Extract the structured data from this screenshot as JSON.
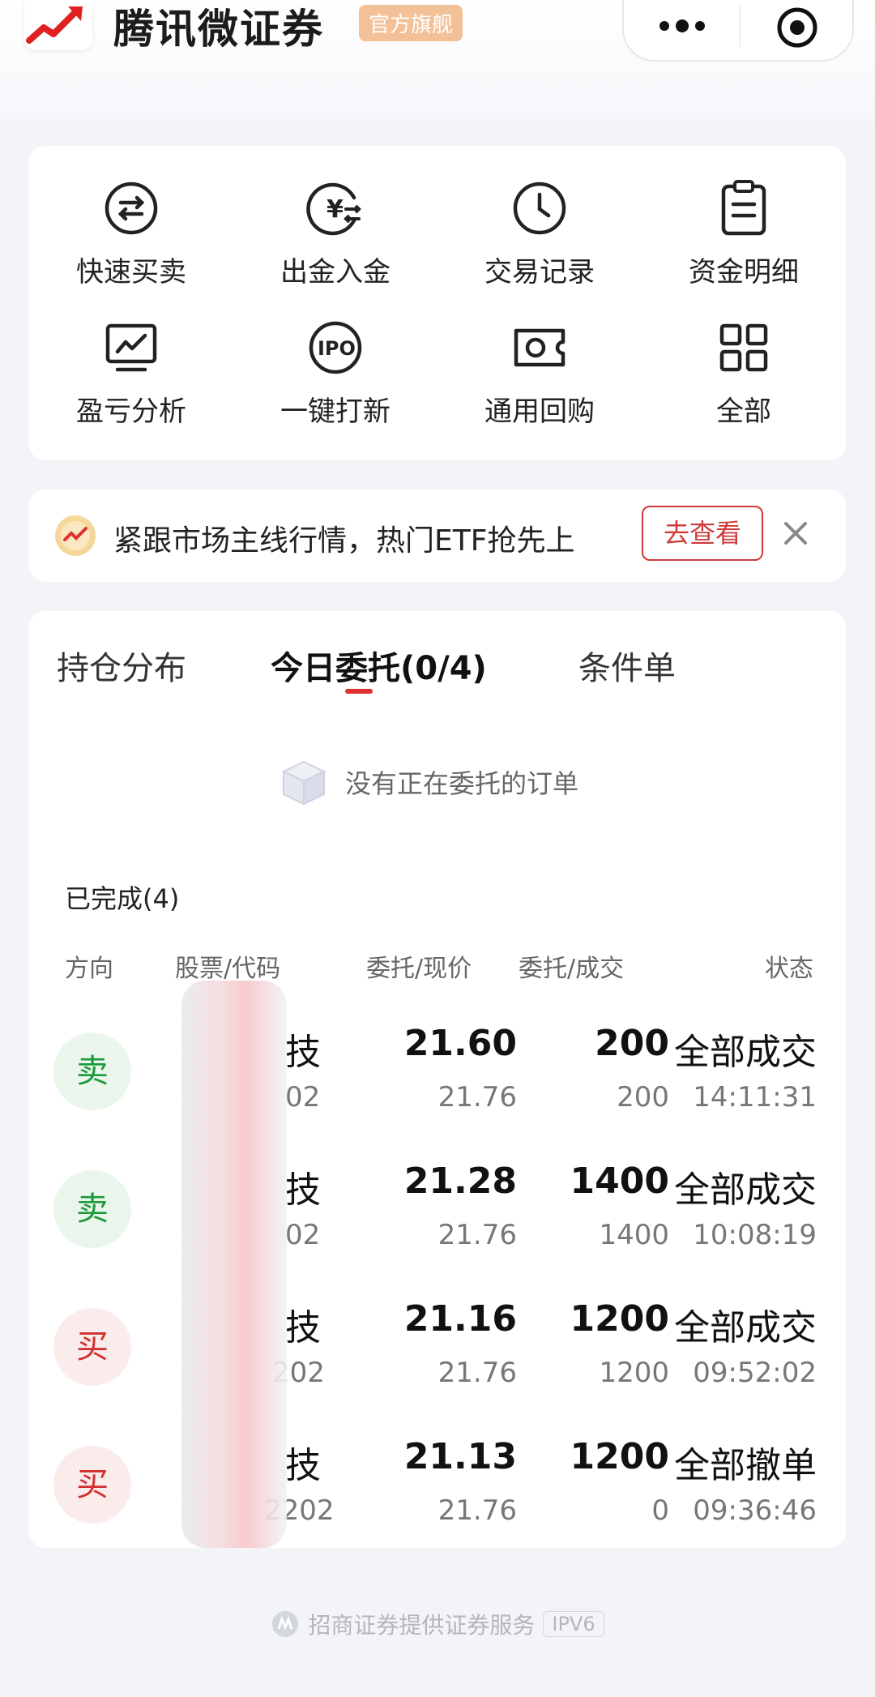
{
  "header": {
    "title": "腾讯微证券",
    "badge": "官方旗舰"
  },
  "quick_actions": [
    {
      "label": "快速买卖",
      "icon": "swap-icon"
    },
    {
      "label": "出金入金",
      "icon": "yuan-transfer-icon"
    },
    {
      "label": "交易记录",
      "icon": "clock-icon"
    },
    {
      "label": "资金明细",
      "icon": "clipboard-icon"
    },
    {
      "label": "盈亏分析",
      "icon": "chart-monitor-icon"
    },
    {
      "label": "一键打新",
      "icon": "ipo-icon"
    },
    {
      "label": "通用回购",
      "icon": "ticket-icon"
    },
    {
      "label": "全部",
      "icon": "grid-icon"
    }
  ],
  "banner": {
    "text": "紧跟市场主线行情，热门ETF抢先上",
    "button": "去查看"
  },
  "tabs": [
    {
      "label": "持仓分布",
      "active": false
    },
    {
      "label": "今日委托(0/4)",
      "active": true
    },
    {
      "label": "条件单",
      "active": false
    }
  ],
  "empty_state": "没有正在委托的订单",
  "completed": {
    "title": "已完成(4)",
    "columns": [
      "方向",
      "股票/代码",
      "委托/现价",
      "委托/成交",
      "状态"
    ],
    "rows": [
      {
        "direction": "卖",
        "type": "sell",
        "name_tail": "技",
        "code_tail": "02",
        "order_price": "21.60",
        "current_price": "21.76",
        "order_qty": "200",
        "filled_qty": "200",
        "status": "全部成交",
        "time": "14:11:31"
      },
      {
        "direction": "卖",
        "type": "sell",
        "name_tail": "技",
        "code_tail": "02",
        "order_price": "21.28",
        "current_price": "21.76",
        "order_qty": "1400",
        "filled_qty": "1400",
        "status": "全部成交",
        "time": "10:08:19"
      },
      {
        "direction": "买",
        "type": "buy",
        "name_tail": "技",
        "code_tail": "202",
        "order_price": "21.16",
        "current_price": "21.76",
        "order_qty": "1200",
        "filled_qty": "1200",
        "status": "全部成交",
        "time": "09:52:02"
      },
      {
        "direction": "买",
        "type": "buy",
        "name_tail": "技",
        "code_tail": "2202",
        "order_price": "21.13",
        "current_price": "21.76",
        "order_qty": "1200",
        "filled_qty": "0",
        "status": "全部撤单",
        "time": "09:36:46"
      }
    ]
  },
  "footer": {
    "text": "招商证券提供证券服务",
    "badge": "IPV6"
  }
}
